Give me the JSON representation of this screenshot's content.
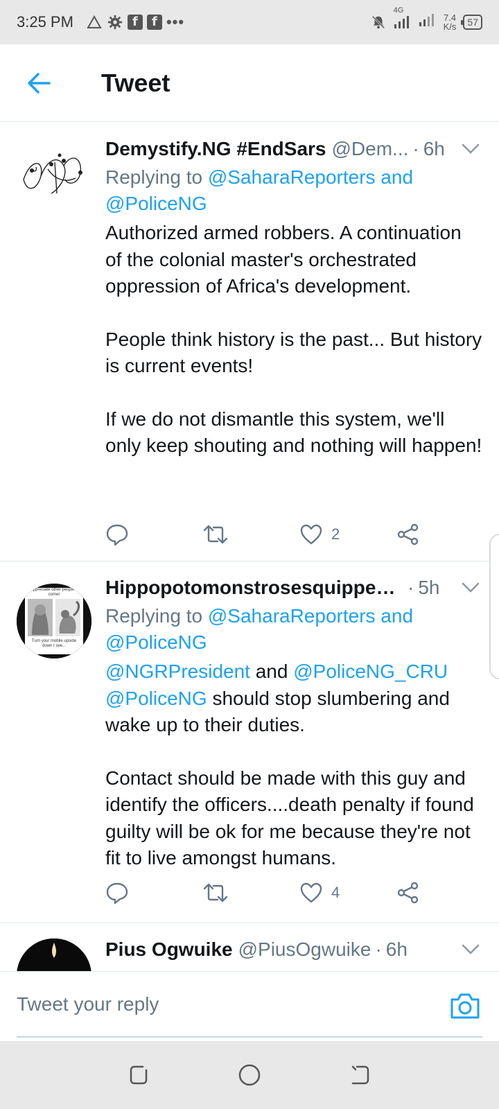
{
  "status_bar": {
    "time": "3:25 PM",
    "network_type": "4G",
    "net_speed_value": "7.4",
    "net_speed_unit": "K/s",
    "battery": "57"
  },
  "header": {
    "title": "Tweet"
  },
  "tweets": [
    {
      "name": "Demystify.NG #EndSars",
      "handle": "@Dem...",
      "time": "6h",
      "reply_prefix": "Replying to ",
      "reply_mention_1": "@SaharaReporters",
      "reply_and": " and",
      "reply_mention_2": "@PoliceNG",
      "paragraphs": [
        "Authorized armed robbers. A continuation of the colonial master's orchestrated oppression of Africa's development.",
        "People think history is the past... But history is current events!",
        "If we do not dismantle this system, we'll only keep shouting and nothing will happen!"
      ],
      "like_count": "2"
    },
    {
      "name": "Hippopotomonstrosesquipped...",
      "time": "5h",
      "reply_prefix": "Replying to ",
      "reply_mention_1": "@SaharaReporters",
      "reply_and": " and",
      "reply_mention_2": "@PoliceNG",
      "body_mention_1": "@NGRPresident",
      "body_and": " and ",
      "body_mention_2": "@PoliceNG_CRU",
      "body_mention_3": "@PoliceNG",
      "body_text_1": " should stop slumbering and wake up to their duties.",
      "paragraph_2": "Contact should be made with this guy and identify the officers....death penalty if found guilty will be ok for me because they're not fit to live amongst humans.",
      "like_count": "4",
      "avatar_text_top": "appreciate other people's corner",
      "avatar_text_bottom": "Turn your mobile upside down I see..."
    },
    {
      "name": "Pius Ogwuike",
      "handle": "@PiusOgwuike",
      "time": "6h"
    }
  ],
  "reply_bar": {
    "placeholder": "Tweet your reply"
  },
  "icons": {
    "accent": "#1da1f2",
    "secondary": "#657786"
  }
}
